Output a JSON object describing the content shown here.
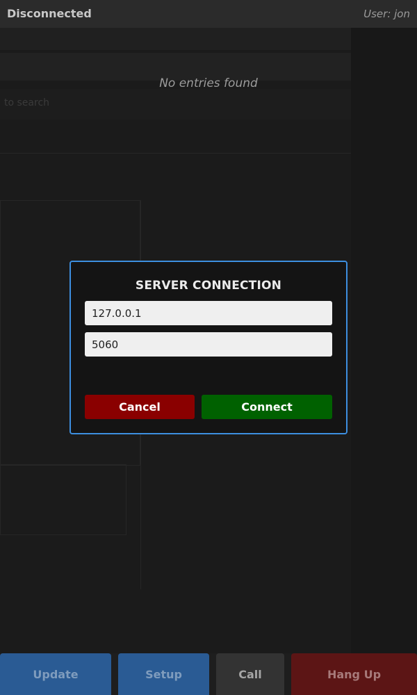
{
  "header": {
    "status": "Disconnected",
    "user": "User: jon"
  },
  "main": {
    "empty_message": "No entries found"
  },
  "dialog": {
    "title": "SERVER CONNECTION",
    "host_value": "127.0.0.1",
    "port_value": "5060",
    "cancel_label": "Cancel",
    "connect_label": "Connect"
  },
  "actions": {
    "update_label": "Update",
    "setup_label": "Setup",
    "call_label": "Call",
    "hangup_label": "Hang Up"
  },
  "background": {
    "search_hint": "to search"
  },
  "colors": {
    "dialog_border": "#3d8fe0",
    "cancel": "#8a0000",
    "connect": "#006100",
    "update": "#2a5b94",
    "setup": "#2a5b94",
    "call": "#333333",
    "hangup": "#5c1515"
  }
}
